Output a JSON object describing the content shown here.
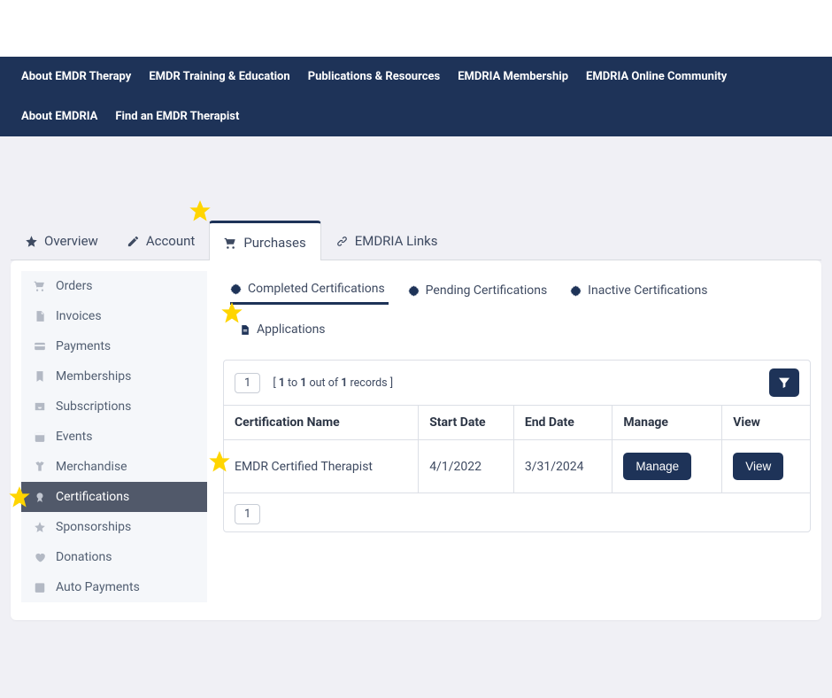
{
  "top_nav": {
    "items": [
      "About EMDR Therapy",
      "EMDR Training & Education",
      "Publications & Resources",
      "EMDRIA Membership",
      "EMDRIA Online Community",
      "About EMDRIA",
      "Find an EMDR Therapist"
    ]
  },
  "tabs": {
    "overview": "Overview",
    "account": "Account",
    "purchases": "Purchases",
    "links": "EMDRIA Links"
  },
  "sidebar": {
    "items": [
      "Orders",
      "Invoices",
      "Payments",
      "Memberships",
      "Subscriptions",
      "Events",
      "Merchandise",
      "Certifications",
      "Sponsorships",
      "Donations",
      "Auto Payments"
    ]
  },
  "subtabs": {
    "completed": "Completed Certifications",
    "pending": "Pending Certifications",
    "inactive": "Inactive Certifications",
    "applications": "Applications"
  },
  "records_text": {
    "open": "[ ",
    "n1": "1",
    "to": " to ",
    "n2": "1",
    "outof": " out of ",
    "n3": "1",
    "tail": " records ]"
  },
  "page_chip": "1",
  "page_chip_bottom": "1",
  "table": {
    "headers": {
      "name": "Certification Name",
      "start": "Start Date",
      "end": "End Date",
      "manage": "Manage",
      "view": "View"
    },
    "rows": [
      {
        "name": "EMDR Certified Therapist",
        "start": "4/1/2022",
        "end": "3/31/2024",
        "manage_label": "Manage",
        "view_label": "View"
      }
    ]
  },
  "colors": {
    "star": "#ffd500"
  }
}
